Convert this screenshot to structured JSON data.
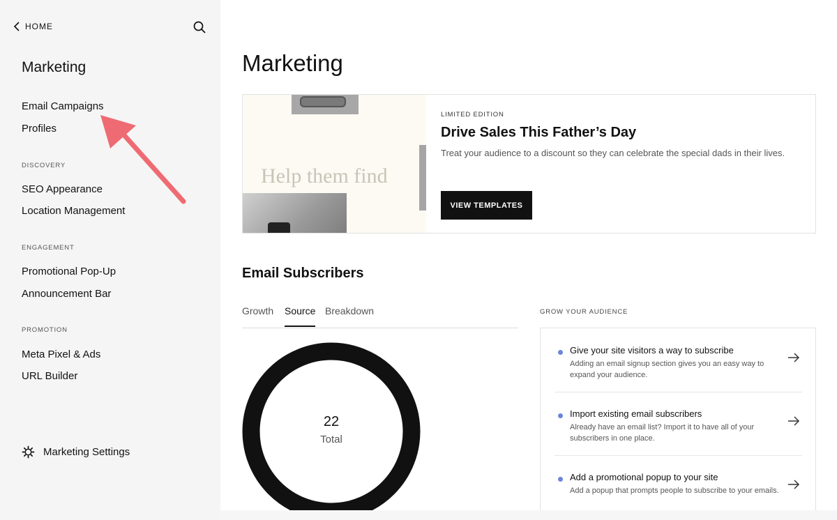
{
  "sidebar": {
    "home_label": "HOME",
    "title": "Marketing",
    "top_items": [
      "Email Campaigns",
      "Profiles"
    ],
    "sections": [
      {
        "label": "DISCOVERY",
        "items": [
          "SEO Appearance",
          "Location Management"
        ]
      },
      {
        "label": "ENGAGEMENT",
        "items": [
          "Promotional Pop-Up",
          "Announcement Bar"
        ]
      },
      {
        "label": "PROMOTION",
        "items": [
          "Meta Pixel & Ads",
          "URL Builder"
        ]
      }
    ],
    "settings_label": "Marketing Settings"
  },
  "main": {
    "title": "Marketing",
    "promo": {
      "image_text": "Help them find",
      "eyebrow": "LIMITED EDITION",
      "heading": "Drive Sales This Father’s Day",
      "body": "Treat your audience to a discount so they can celebrate the special dads in their lives.",
      "button": "VIEW TEMPLATES"
    },
    "subscribers": {
      "title": "Email Subscribers",
      "tabs": [
        "Growth",
        "Source",
        "Breakdown"
      ],
      "active_tab": "Source",
      "total_value": "22",
      "total_label": "Total"
    },
    "grow": {
      "label": "GROW YOUR AUDIENCE",
      "items": [
        {
          "title": "Give your site visitors a way to subscribe",
          "desc": "Adding an email signup section gives you an easy way to expand your audience."
        },
        {
          "title": "Import existing email subscribers",
          "desc": "Already have an email list? Import it to have all of your subscribers in one place."
        },
        {
          "title": "Add a promotional popup to your site",
          "desc": "Add a popup that prompts people to subscribe to your emails."
        }
      ]
    }
  },
  "colors": {
    "accent_dot": "#6b85d8",
    "annotation_arrow": "#ef6b73",
    "button_bg": "#111111"
  },
  "icons": [
    "chevron-left-icon",
    "search-icon",
    "gear-icon",
    "arrow-right-icon"
  ]
}
